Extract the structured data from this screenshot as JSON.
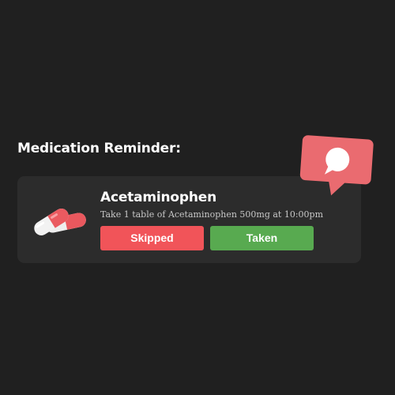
{
  "page": {
    "heading": "Medication Reminder:"
  },
  "reminder": {
    "medication_name": "Acetaminophen",
    "instruction": "Take 1 table of Acetaminophen 500mg at 10:00pm",
    "skipped_label": "Skipped",
    "taken_label": "Taken",
    "pill_icon": "capsules-icon"
  },
  "notification": {
    "icon": "chat-bubble-icon"
  },
  "colors": {
    "background": "#202020",
    "card": "#2c2c2c",
    "skipped": "#f15459",
    "taken": "#58aa50",
    "bubble": "#ea6b70"
  }
}
